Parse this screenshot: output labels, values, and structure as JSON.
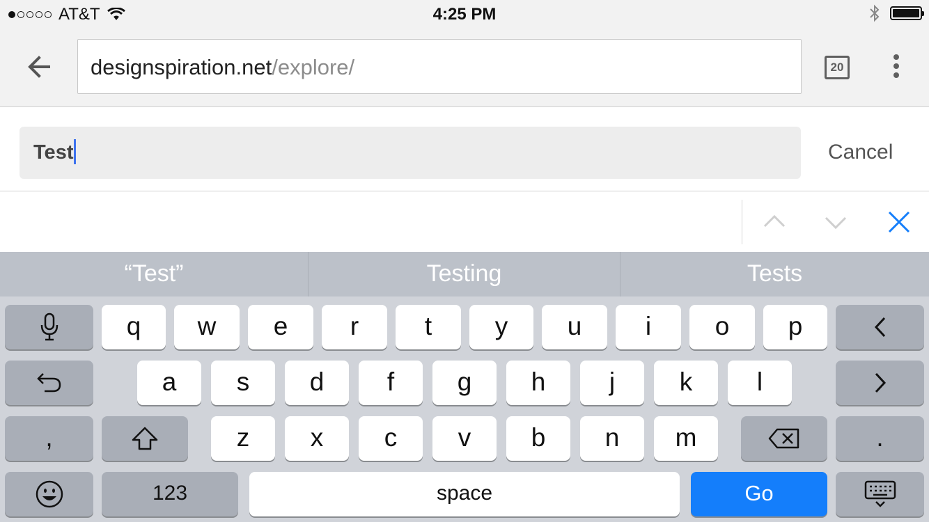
{
  "status_bar": {
    "carrier": "AT&T",
    "time": "4:25 PM",
    "signal_bars_filled": 1,
    "signal_bars_total": 5
  },
  "browser": {
    "url_domain": "designspiration.net",
    "url_path": "/explore/",
    "tab_count": "20"
  },
  "find": {
    "query": "Test",
    "cancel_label": "Cancel"
  },
  "keyboard": {
    "suggestions": [
      "“Test”",
      "Testing",
      "Tests"
    ],
    "row1": [
      "q",
      "w",
      "e",
      "r",
      "t",
      "y",
      "u",
      "i",
      "o",
      "p"
    ],
    "row2": [
      "a",
      "s",
      "d",
      "f",
      "g",
      "h",
      "j",
      "k",
      "l"
    ],
    "row3": [
      "z",
      "x",
      "c",
      "v",
      "b",
      "n",
      "m"
    ],
    "comma": ",",
    "period": ".",
    "numbers_label": "123",
    "space_label": "space",
    "go_label": "Go",
    "accent_color": "#147efb"
  },
  "icons": [
    "bluetooth-icon",
    "battery-icon",
    "wifi-icon",
    "back-arrow-icon",
    "more-menu-icon",
    "find-previous-icon",
    "find-next-icon",
    "close-find-icon",
    "microphone-icon",
    "undo-icon",
    "cursor-left-icon",
    "cursor-right-icon",
    "shift-icon",
    "backspace-icon",
    "emoji-icon",
    "dismiss-keyboard-icon"
  ]
}
